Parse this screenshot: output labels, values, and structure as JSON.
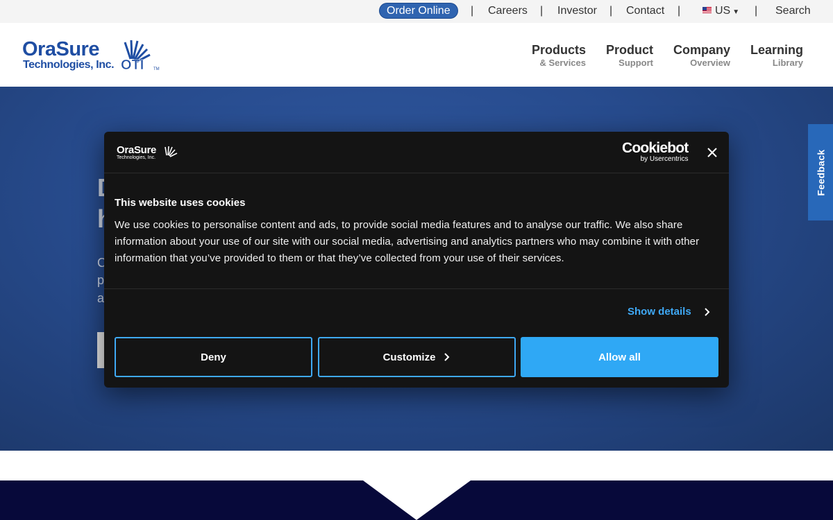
{
  "topbar": {
    "order_online": "Order Online",
    "separator": "|",
    "careers": "Careers",
    "investor": "Investor",
    "contact": "Contact",
    "region": "US",
    "search": "Search"
  },
  "logo": {
    "line1": "OraSure",
    "line2": "Technologies, Inc.",
    "mark": "OTI",
    "tm": "TM"
  },
  "nav": [
    {
      "main": "Products",
      "sub": "& Services"
    },
    {
      "main": "Product",
      "sub": "Support"
    },
    {
      "main": "Company",
      "sub": "Overview"
    },
    {
      "main": "Learning",
      "sub": "Library"
    }
  ],
  "hero": {
    "partial_line1": "D",
    "partial_line2": "h",
    "partial_p1": "C",
    "partial_p2": "p",
    "partial_p3": "a"
  },
  "feedback": "Feedback",
  "cookie": {
    "brand_line1": "OraSure",
    "brand_line2": "Technologies, Inc.",
    "cookiebot": "Cookiebot",
    "cookiebot_sub": "by Usercentrics",
    "title": "This website uses cookies",
    "body": "We use cookies to personalise content and ads, to provide social media features and to analyse our traffic. We also share information about your use of our site with our social media, advertising and analytics partners who may combine it with other information that you’ve provided to them or that they’ve collected from your use of their services.",
    "show_details": "Show details",
    "deny": "Deny",
    "customize": "Customize",
    "allow_all": "Allow all"
  },
  "colors": {
    "brand_blue": "#1f4ea3",
    "accent": "#2fa8f5",
    "dialog_bg": "#141414",
    "hero_blue": "#274b8d"
  }
}
